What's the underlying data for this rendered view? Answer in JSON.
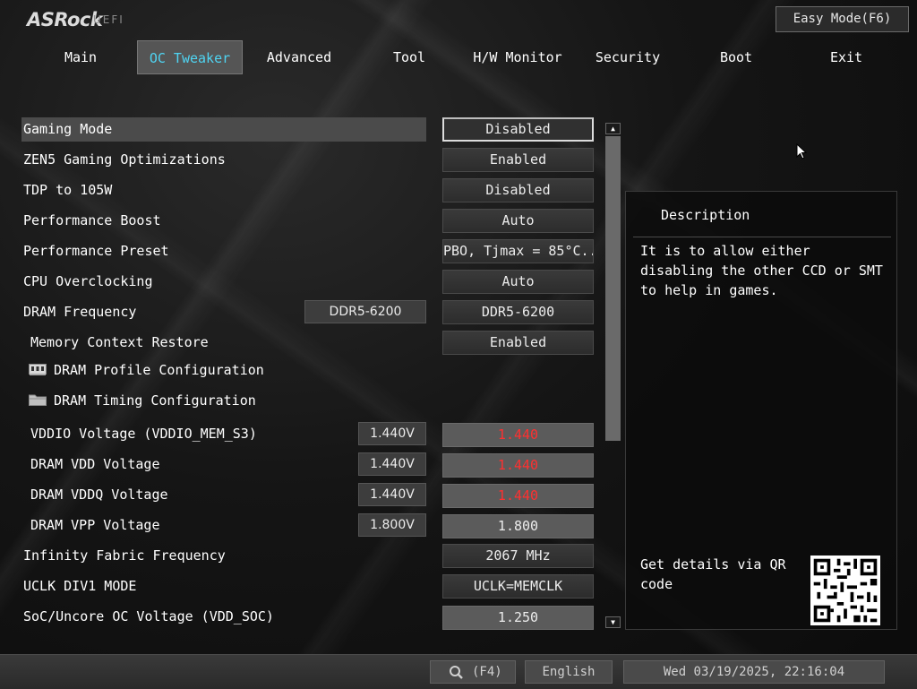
{
  "brand": {
    "logo": "ASRock",
    "sub": "UEFI"
  },
  "easy_mode_label": "Easy Mode(F6)",
  "tabs": [
    {
      "label": "Main"
    },
    {
      "label": "OC Tweaker"
    },
    {
      "label": "Advanced"
    },
    {
      "label": "Tool"
    },
    {
      "label": "H/W Monitor"
    },
    {
      "label": "Security"
    },
    {
      "label": "Boot"
    },
    {
      "label": "Exit"
    }
  ],
  "active_tab": "OC Tweaker",
  "settings": [
    {
      "label": "Gaming Mode",
      "value": "Disabled"
    },
    {
      "label": "ZEN5 Gaming Optimizations",
      "value": "Enabled"
    },
    {
      "label": "TDP to 105W",
      "value": "Disabled"
    },
    {
      "label": "Performance Boost",
      "value": "Auto"
    },
    {
      "label": "Performance Preset",
      "value": "PBO, Tjmax = 85°C..."
    },
    {
      "label": "CPU Overclocking",
      "value": "Auto"
    },
    {
      "label": "DRAM Frequency",
      "current": "DDR5-6200",
      "value": "DDR5-6200"
    },
    {
      "label": "Memory Context Restore",
      "value": "Enabled"
    },
    {
      "label": "DRAM Profile Configuration",
      "icon": "memory-module-icon"
    },
    {
      "label": "DRAM Timing Configuration",
      "icon": "folder-icon"
    },
    {
      "label": "VDDIO Voltage (VDDIO_MEM_S3)",
      "current": "1.440V",
      "value": "1.440"
    },
    {
      "label": "DRAM VDD Voltage",
      "current": "1.440V",
      "value": "1.440"
    },
    {
      "label": "DRAM VDDQ Voltage",
      "current": "1.440V",
      "value": "1.440"
    },
    {
      "label": "DRAM VPP Voltage",
      "current": "1.800V",
      "value": "1.800"
    },
    {
      "label": "Infinity Fabric Frequency",
      "value": "2067 MHz"
    },
    {
      "label": "UCLK DIV1 MODE",
      "value": "UCLK=MEMCLK"
    },
    {
      "label": "SoC/Uncore OC Voltage (VDD_SOC)",
      "value": "1.250"
    }
  ],
  "description": {
    "title": "Description",
    "text": "It is to allow either disabling the other CCD or SMT to help in games.",
    "qr_text": "Get details via QR code"
  },
  "bottom": {
    "search_label": "(F4)",
    "language": "English",
    "datetime": "Wed 03/19/2025, 22:16:04"
  },
  "colors": {
    "accent": "#4fd4f2",
    "warning_value": "#ff3030"
  }
}
